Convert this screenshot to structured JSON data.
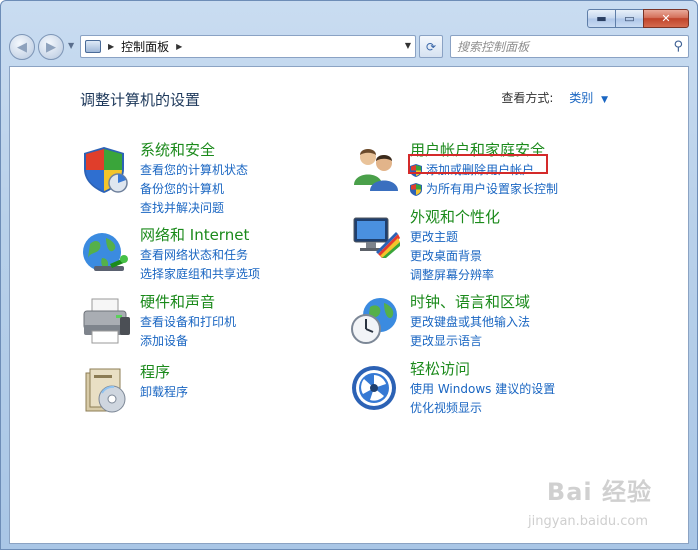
{
  "window": {
    "caption": {
      "minimize": "▬",
      "maximize": "▭",
      "close": "✕"
    }
  },
  "toolbar": {
    "address": {
      "crumb": "控制面板"
    },
    "search": {
      "placeholder": "搜索控制面板"
    }
  },
  "header": {
    "title": "调整计算机的设置",
    "view_by_label": "查看方式:",
    "view_by_value": "类别"
  },
  "categories": [
    {
      "title": "系统和安全",
      "icon": "shield-icon",
      "links": [
        "查看您的计算机状态",
        "备份您的计算机",
        "查找并解决问题"
      ]
    },
    {
      "title": "网络和 Internet",
      "icon": "network-globe-icon",
      "links": [
        "查看网络状态和任务",
        "选择家庭组和共享选项"
      ]
    },
    {
      "title": "硬件和声音",
      "icon": "printer-icon",
      "links": [
        "查看设备和打印机",
        "添加设备"
      ]
    },
    {
      "title": "程序",
      "icon": "programs-icon",
      "links": [
        "卸载程序"
      ]
    },
    {
      "title": "用户帐户和家庭安全",
      "icon": "users-icon",
      "links": [
        "添加或删除用户帐户",
        "为所有用户设置家长控制"
      ]
    },
    {
      "title": "外观和个性化",
      "icon": "appearance-icon",
      "links": [
        "更改主题",
        "更改桌面背景",
        "调整屏幕分辨率"
      ]
    },
    {
      "title": "时钟、语言和区域",
      "icon": "clock-globe-icon",
      "links": [
        "更改键盘或其他输入法",
        "更改显示语言"
      ]
    },
    {
      "title": "轻松访问",
      "icon": "ease-of-access-icon",
      "links": [
        "使用 Windows 建议的设置",
        "优化视频显示"
      ]
    }
  ],
  "watermark": {
    "brand": "Bai 经验",
    "url": "jingyan.baidu.com"
  },
  "colors": {
    "category_title": "#1b8a1b",
    "link": "#1a66c2",
    "highlight_box": "#d42a2a"
  }
}
